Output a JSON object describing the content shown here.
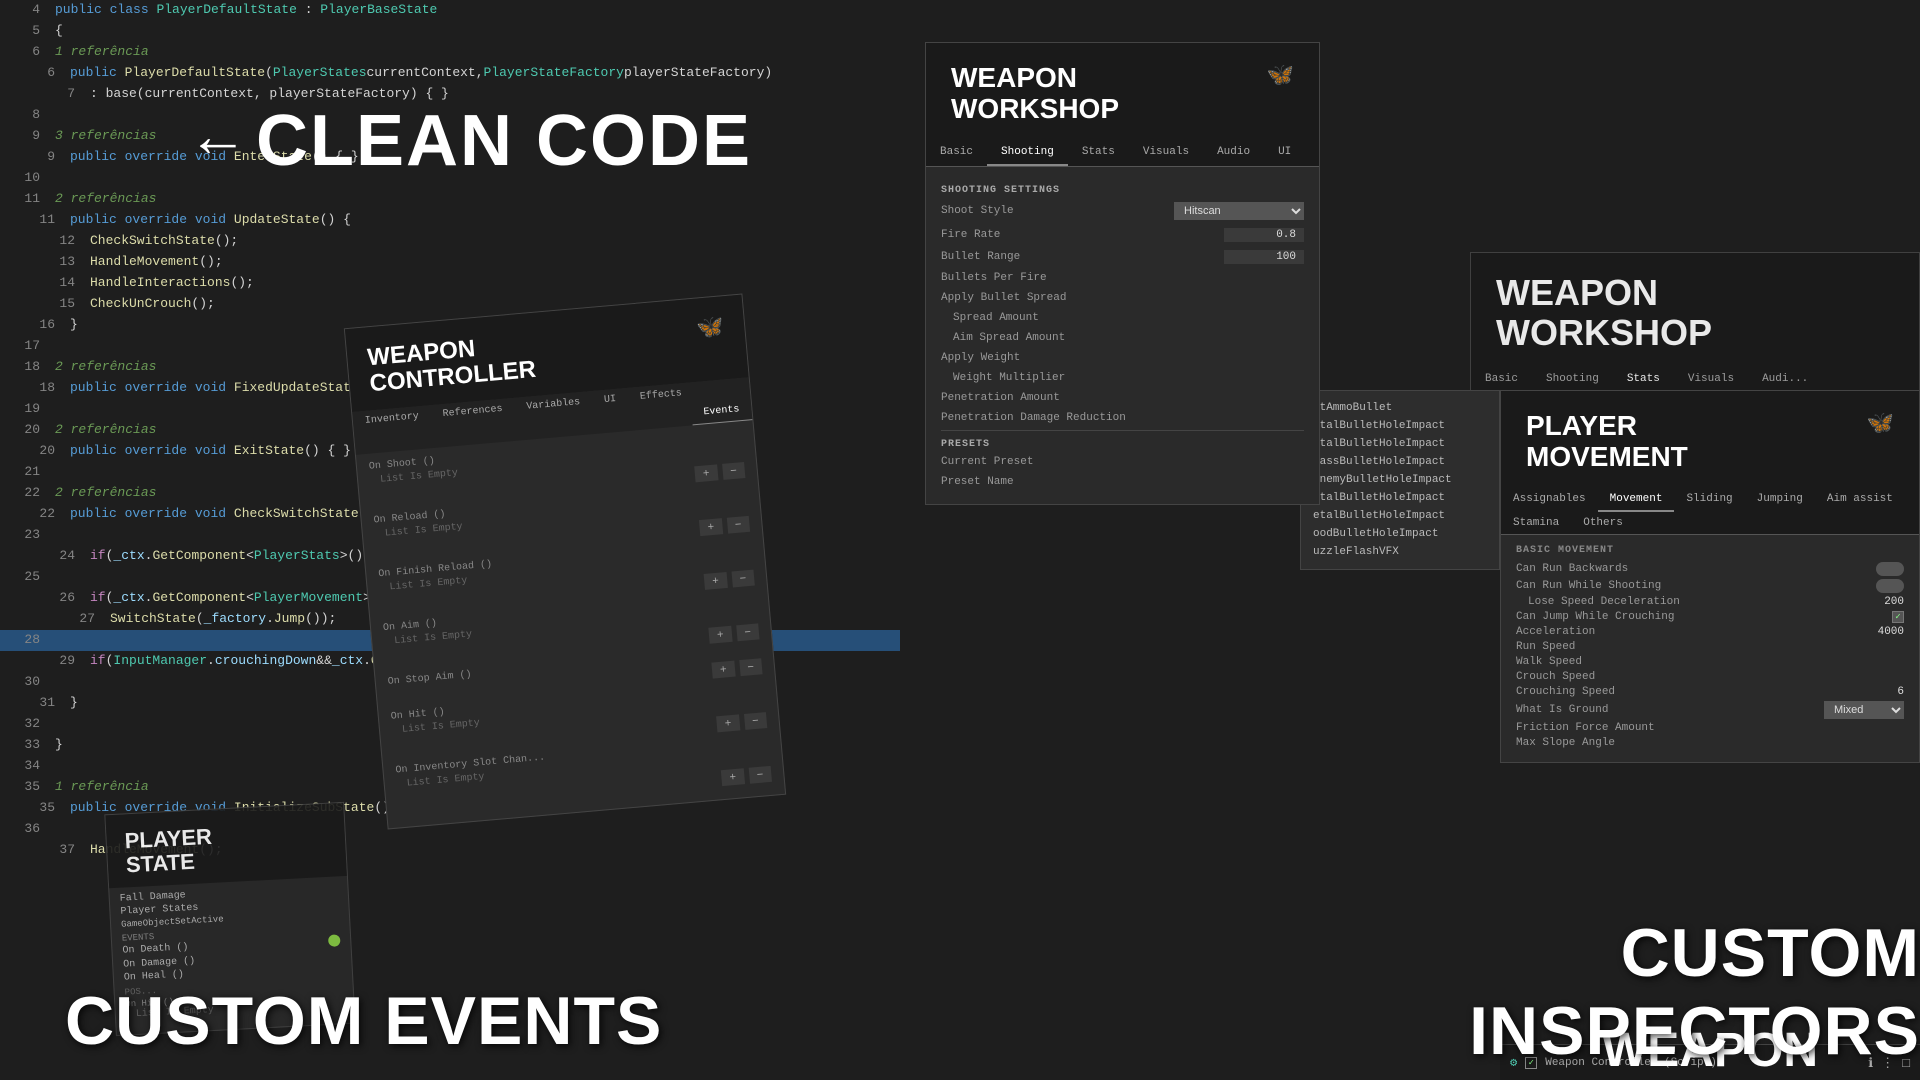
{
  "editor": {
    "lines": [
      {
        "num": 4,
        "content": "public class PlayerDefaultState : PlayerBaseState",
        "indent": 0
      },
      {
        "num": 5,
        "content": "{",
        "indent": 0
      },
      {
        "num": 6,
        "ref": "1 referência",
        "content": "public PlayerDefaultState(PlayerStates currentContext, PlayerStateFactory playerStateFactory)",
        "indent": 1
      },
      {
        "num": 7,
        "content": ": base(currentContext, playerStateFactory) { }",
        "indent": 2
      },
      {
        "num": 8,
        "content": "",
        "indent": 0
      },
      {
        "num": 9,
        "ref": "3 referências",
        "content": "public override void EnterState() { }",
        "indent": 1
      },
      {
        "num": 10,
        "content": "",
        "indent": 0
      },
      {
        "num": 11,
        "ref": "2 referências",
        "content": "public override void UpdateState() {",
        "indent": 1
      },
      {
        "num": 12,
        "content": "CheckSwitchState();",
        "indent": 2
      },
      {
        "num": 13,
        "content": "HandleMovement();",
        "indent": 2
      },
      {
        "num": 14,
        "content": "HandleInteractions();",
        "indent": 2
      },
      {
        "num": 15,
        "content": "CheckUnCrouch();",
        "indent": 2
      },
      {
        "num": 16,
        "content": "}",
        "indent": 1
      },
      {
        "num": 17,
        "content": "",
        "indent": 0
      },
      {
        "num": 18,
        "ref": "2 referências",
        "content": "public override void FixedUpdateState() { HandleMovement(); }",
        "indent": 1
      },
      {
        "num": 19,
        "content": "",
        "indent": 0
      },
      {
        "num": 20,
        "ref": "2 referências",
        "content": "public override void ExitState() { }",
        "indent": 1
      },
      {
        "num": 21,
        "content": "",
        "indent": 0
      },
      {
        "num": 22,
        "ref": "2 referências",
        "content": "public override void CheckSwitchState() {",
        "indent": 1
      },
      {
        "num": 23,
        "content": "",
        "indent": 0
      },
      {
        "num": 24,
        "content": "if(_ctx.GetComponent<PlayerStats>().health <= 0 ) Swit...",
        "indent": 2
      },
      {
        "num": 25,
        "content": "",
        "indent": 0
      },
      {
        "num": 26,
        "content": "if (_ctx.GetComponent<PlayerMovement>().CanJump &&  In...",
        "indent": 2
      },
      {
        "num": 27,
        "content": "SwitchState(_factory.Jump());",
        "indent": 3
      },
      {
        "num": 28,
        "content": "",
        "indent": 0,
        "highlight": true
      },
      {
        "num": 29,
        "content": "if(InputManager.crouchingDown && _ctx.GetComponent<...",
        "indent": 2
      },
      {
        "num": 30,
        "content": "",
        "indent": 0
      },
      {
        "num": 31,
        "content": "}",
        "indent": 1
      },
      {
        "num": 32,
        "content": "",
        "indent": 0
      },
      {
        "num": 33,
        "content": "}",
        "indent": 0
      },
      {
        "num": 34,
        "content": "",
        "indent": 0
      },
      {
        "num": 35,
        "ref": "1 referência",
        "content": "public override void InitializeSubState() {",
        "indent": 1
      },
      {
        "num": 36,
        "content": "",
        "indent": 0
      },
      {
        "num": 37,
        "content": "HandleMovement();",
        "indent": 2
      }
    ]
  },
  "clean_code": {
    "arrow": "←",
    "label": "CLEAN CODE"
  },
  "weapon_workshop_1": {
    "title": "WEAPON\nWORKSHOP",
    "butterfly": "🦋",
    "tabs": [
      "Basic",
      "Shooting",
      "Stats",
      "Visuals",
      "Audio",
      "UI"
    ],
    "active_tab": "Shooting",
    "section": "Shooting Settings",
    "fields": [
      {
        "label": "Shoot Style",
        "value": "Hitscan"
      },
      {
        "label": "Fire Rate",
        "value": "0.8"
      },
      {
        "label": "Bullet Range",
        "value": "100"
      },
      {
        "label": "Bullets Per Fire",
        "value": ""
      },
      {
        "label": "Apply Bullet Spread",
        "value": ""
      },
      {
        "label": "Spread Amount",
        "value": ""
      },
      {
        "label": "Aim Spread Amount",
        "value": ""
      },
      {
        "label": "Apply Weight",
        "value": ""
      },
      {
        "label": "Weight Multiplier",
        "value": ""
      },
      {
        "label": "Penetration Amount",
        "value": ""
      },
      {
        "label": "Penetration Damage Reduction",
        "value": ""
      }
    ],
    "presets_section": "PRESETS",
    "presets_fields": [
      {
        "label": "Current Preset",
        "value": ""
      },
      {
        "label": "Preset Name",
        "value": ""
      }
    ]
  },
  "weapon_workshop_2": {
    "title": "WEAPON\nWORKSHOP",
    "tabs": [
      "Basic",
      "Shooting",
      "Stats",
      "Visuals",
      "Audi..."
    ],
    "active_tab": "Stats"
  },
  "weapon_controller": {
    "title": "WEAPON\nCONTROLLER",
    "butterfly": "🦋",
    "tabs": [
      "Inventory",
      "References",
      "Variables",
      "UI",
      "Effects"
    ],
    "active_tab": "Events",
    "events_tab": "Events",
    "sections": [
      {
        "name": "On Shoot ()",
        "list_label": "List Is Empty"
      },
      {
        "name": "On Reload ()",
        "list_label": "List Is Empty"
      },
      {
        "name": "On Finish Reload ()",
        "list_label": "List Is Empty"
      },
      {
        "name": "On Aim ()",
        "list_label": "List Is Empty"
      },
      {
        "name": "On Stop Aim ()",
        "list_label": "List Is Empty"
      },
      {
        "name": "On Hit ()",
        "list_label": "List Is Empty"
      },
      {
        "name": "On Inventory Slot Chan...",
        "list_label": "List Is Empty"
      }
    ]
  },
  "player_state": {
    "title": "PLAYER\nSTATE",
    "fields": [
      {
        "label": "Fall Damage",
        "value": ""
      },
      {
        "label": "Player States",
        "value": ""
      },
      {
        "label": "GameObjectSetActive",
        "value": ""
      }
    ],
    "sections": [
      {
        "name": "Events",
        "items": [
          {
            "label": "On Death ()",
            "value": ""
          },
          {
            "label": "On Damage ()",
            "value": ""
          },
          {
            "label": "On Heal ()",
            "value": ""
          }
        ]
      }
    ],
    "bottom_items": [
      "POS...",
      "On Hit ()"
    ]
  },
  "player_movement": {
    "title": "PLAYER\nMOVEMENT",
    "butterfly": "🦋",
    "tabs": [
      "Assignables",
      "Movement",
      "Sliding",
      "Jumping",
      "Aim assist",
      "Stamina",
      "Others"
    ],
    "active_tab": "Movement",
    "section": "BASIC MOVEMENT",
    "fields": [
      {
        "label": "Can Run Backwards",
        "value": "",
        "type": "toggle"
      },
      {
        "label": "Can Run While Shooting",
        "value": "",
        "type": "toggle"
      },
      {
        "label": "Lose Speed Deceleration",
        "value": "200",
        "type": "number"
      },
      {
        "label": "Can Jump While Crouching",
        "value": "✓",
        "type": "check"
      },
      {
        "label": "Acceleration",
        "value": "4000",
        "type": "number"
      },
      {
        "label": "Run Speed",
        "value": "",
        "type": "number"
      },
      {
        "label": "Walk Speed",
        "value": "",
        "type": "number"
      },
      {
        "label": "Crouch Speed",
        "value": "",
        "type": "number"
      },
      {
        "label": "Crouching Speed",
        "value": "6",
        "type": "number"
      },
      {
        "label": "What Is Ground",
        "value": "Mixed",
        "type": "select"
      },
      {
        "label": "Friction Force Amount",
        "value": "",
        "type": "number"
      },
      {
        "label": "Max Slope Angle",
        "value": "",
        "type": "number"
      }
    ]
  },
  "right_list": {
    "items": [
      "htAmmoBullet",
      "etalBulletHoleImpact",
      "etalBulletHoleImpact",
      "rassBulletHoleImpact",
      "enemyBulletHoleImpact",
      "etalBulletHoleImpact",
      "etalBulletHoleImpact",
      "oodBulletHoleImpact",
      "uzzleFlashVFX"
    ]
  },
  "bottom_bar": {
    "icon_label": "⚙",
    "script_name": "Weapon Controller (Script)",
    "buttons": [
      "ℹ",
      "⋮",
      "□"
    ]
  },
  "overlay_texts": {
    "custom_events": "CUSTOM EVENTS",
    "custom_inspectors_line1": "CUSTOM",
    "custom_inspectors_line2": "INSPECTORS",
    "weapon_bottom": "WEAPON"
  }
}
